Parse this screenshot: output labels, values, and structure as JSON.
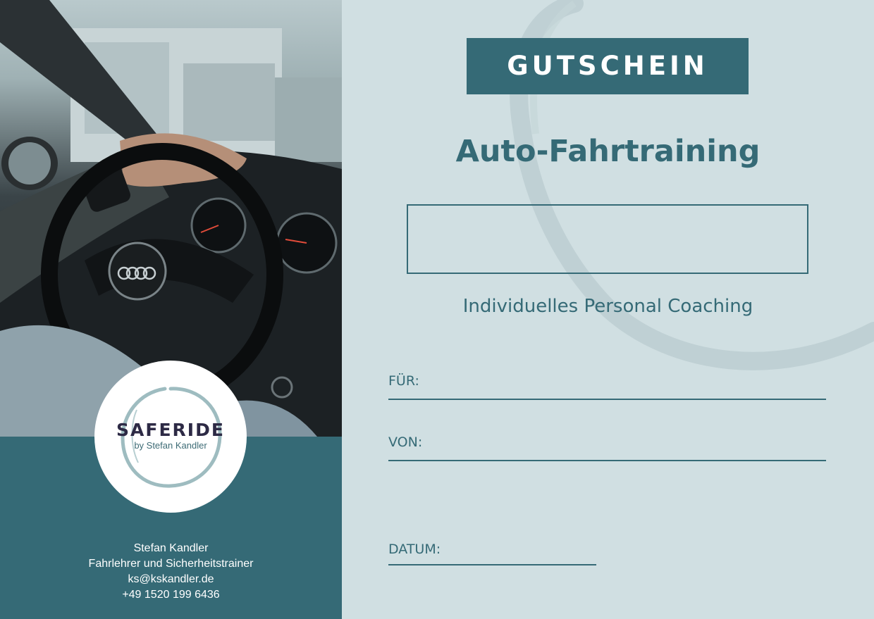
{
  "voucher": {
    "title": "GUTSCHEIN",
    "heading": "Auto-Fahrtraining",
    "value": "",
    "subtitle": "Individuelles Personal Coaching",
    "fields": {
      "for_label": "FÜR:",
      "from_label": "VON:",
      "date_label": "DATUM:"
    }
  },
  "logo": {
    "name": "SAFERIDE",
    "byline": "by Stefan Kandler"
  },
  "contact": {
    "name": "Stefan Kandler",
    "role": "Fahrlehrer und Sicherheitstrainer",
    "email": "ks@kskandler.de",
    "phone": "+49 1520 199 6436"
  },
  "colors": {
    "brand_teal": "#356a76",
    "background": "#d0dfe2",
    "logo_dark": "#2d2a45"
  }
}
